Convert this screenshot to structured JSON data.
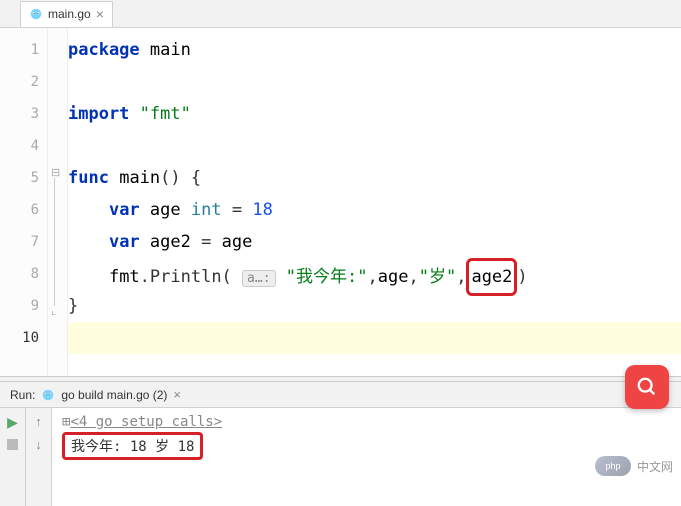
{
  "tab": {
    "filename": "main.go"
  },
  "editor": {
    "line_numbers": [
      "1",
      "2",
      "3",
      "4",
      "5",
      "6",
      "7",
      "8",
      "9",
      "10"
    ],
    "package_kw": "package",
    "package_name": "main",
    "import_kw": "import",
    "import_val": "\"fmt\"",
    "func_kw": "func",
    "func_name": "main",
    "func_sig": "() {",
    "var_kw": "var",
    "age_ident": "age",
    "int_type": "int",
    "eq": "=",
    "eighteen": "18",
    "age2_ident": "age2",
    "fmt_pkg": "fmt",
    "println": ".Println(",
    "hint": "a…:",
    "str1": "\"我今年:\"",
    "comma": ",",
    "str2": "\"岁\"",
    "close_paren": ")",
    "brace_close": "}"
  },
  "run": {
    "label": "Run:",
    "config": "go build main.go (2)",
    "setup": "<4 go setup calls>",
    "output": "我今年: 18 岁 18"
  },
  "watermark": {
    "logo": "php",
    "text": "中文网"
  },
  "colors": {
    "keyword": "#0033b3",
    "string": "#067d17",
    "number": "#1750eb",
    "highlight_box": "#d62027"
  }
}
